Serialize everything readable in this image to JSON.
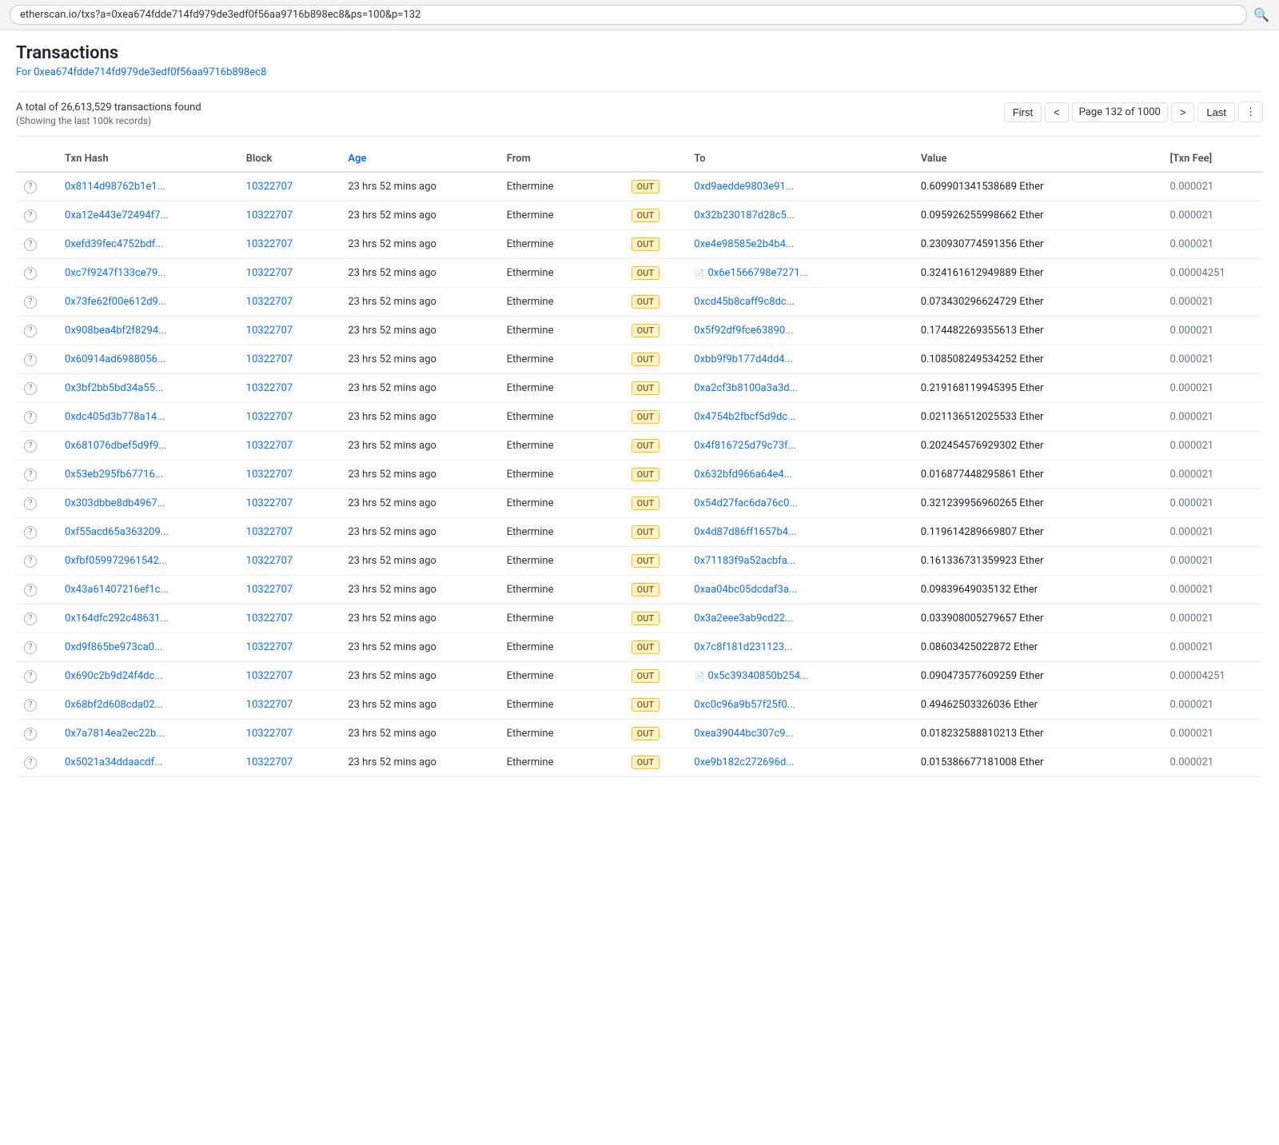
{
  "browser": {
    "url": "etherscan.io/txs?a=0xea674fdde714fd979de3edf0f56aa9716b898ec8&ps=100&p=132",
    "search_icon": "🔍"
  },
  "page": {
    "title": "Transactions",
    "address_label": "For 0xea674fdde714fd979de3edf0f56aa9716b898ec8",
    "address_href": "#"
  },
  "summary": {
    "total_text": "A total of 26,613,529 transactions found",
    "showing_text": "(Showing the last 100k records)"
  },
  "pagination": {
    "first_label": "First",
    "prev_label": "<",
    "page_info": "Page 132 of 1000",
    "next_label": ">",
    "last_label": "Last",
    "more_label": "⋮"
  },
  "table": {
    "columns": [
      {
        "id": "icon",
        "label": ""
      },
      {
        "id": "txn_hash",
        "label": "Txn Hash"
      },
      {
        "id": "block",
        "label": "Block"
      },
      {
        "id": "age",
        "label": "Age",
        "sortable": true
      },
      {
        "id": "from",
        "label": "From"
      },
      {
        "id": "direction",
        "label": ""
      },
      {
        "id": "to",
        "label": "To"
      },
      {
        "id": "value",
        "label": "Value"
      },
      {
        "id": "fee",
        "label": "[Txn Fee]"
      }
    ],
    "rows": [
      {
        "txn_hash": "0x8114d98762b1e1...",
        "block": "10322707",
        "age": "23 hrs 52 mins ago",
        "from": "Ethermine",
        "direction": "OUT",
        "to_icon": false,
        "to": "0xd9aedde9803e91...",
        "value": "0.609901341538689 Ether",
        "fee": "0.000021"
      },
      {
        "txn_hash": "0xa12e443e72494f7...",
        "block": "10322707",
        "age": "23 hrs 52 mins ago",
        "from": "Ethermine",
        "direction": "OUT",
        "to_icon": false,
        "to": "0x32b230187d28c5...",
        "value": "0.095926255998662 Ether",
        "fee": "0.000021"
      },
      {
        "txn_hash": "0xefd39fec4752bdf...",
        "block": "10322707",
        "age": "23 hrs 52 mins ago",
        "from": "Ethermine",
        "direction": "OUT",
        "to_icon": false,
        "to": "0xe4e98585e2b4b4...",
        "value": "0.230930774591356 Ether",
        "fee": "0.000021"
      },
      {
        "txn_hash": "0xc7f9247f133ce79...",
        "block": "10322707",
        "age": "23 hrs 52 mins ago",
        "from": "Ethermine",
        "direction": "OUT",
        "to_icon": true,
        "to": "0x6e1566798e7271...",
        "value": "0.324161612949889 Ether",
        "fee": "0.00004251"
      },
      {
        "txn_hash": "0x73fe62f00e612d9...",
        "block": "10322707",
        "age": "23 hrs 52 mins ago",
        "from": "Ethermine",
        "direction": "OUT",
        "to_icon": false,
        "to": "0xcd45b8caff9c8dc...",
        "value": "0.073430296624729 Ether",
        "fee": "0.000021"
      },
      {
        "txn_hash": "0x908bea4bf2f8294...",
        "block": "10322707",
        "age": "23 hrs 52 mins ago",
        "from": "Ethermine",
        "direction": "OUT",
        "to_icon": false,
        "to": "0x5f92df9fce63890...",
        "value": "0.174482269355613 Ether",
        "fee": "0.000021"
      },
      {
        "txn_hash": "0x60914ad6988056...",
        "block": "10322707",
        "age": "23 hrs 52 mins ago",
        "from": "Ethermine",
        "direction": "OUT",
        "to_icon": false,
        "to": "0xbb9f9b177d4dd4...",
        "value": "0.108508249534252 Ether",
        "fee": "0.000021"
      },
      {
        "txn_hash": "0x3bf2bb5bd34a55...",
        "block": "10322707",
        "age": "23 hrs 52 mins ago",
        "from": "Ethermine",
        "direction": "OUT",
        "to_icon": false,
        "to": "0xa2cf3b8100a3a3d...",
        "value": "0.219168119945395 Ether",
        "fee": "0.000021"
      },
      {
        "txn_hash": "0xdc405d3b778a14...",
        "block": "10322707",
        "age": "23 hrs 52 mins ago",
        "from": "Ethermine",
        "direction": "OUT",
        "to_icon": false,
        "to": "0x4754b2fbcf5d9dc...",
        "value": "0.021136512025533 Ether",
        "fee": "0.000021"
      },
      {
        "txn_hash": "0x681076dbef5d9f9...",
        "block": "10322707",
        "age": "23 hrs 52 mins ago",
        "from": "Ethermine",
        "direction": "OUT",
        "to_icon": false,
        "to": "0x4f816725d79c73f...",
        "value": "0.202454576929302 Ether",
        "fee": "0.000021"
      },
      {
        "txn_hash": "0x53eb295fb67716...",
        "block": "10322707",
        "age": "23 hrs 52 mins ago",
        "from": "Ethermine",
        "direction": "OUT",
        "to_icon": false,
        "to": "0x632bfd966a64e4...",
        "value": "0.016877448295861 Ether",
        "fee": "0.000021"
      },
      {
        "txn_hash": "0x303dbbe8db4967...",
        "block": "10322707",
        "age": "23 hrs 52 mins ago",
        "from": "Ethermine",
        "direction": "OUT",
        "to_icon": false,
        "to": "0x54d27fac6da76c0...",
        "value": "0.321239956960265 Ether",
        "fee": "0.000021"
      },
      {
        "txn_hash": "0xf55acd65a363209...",
        "block": "10322707",
        "age": "23 hrs 52 mins ago",
        "from": "Ethermine",
        "direction": "OUT",
        "to_icon": false,
        "to": "0x4d87d86ff1657b4...",
        "value": "0.119614289669807 Ether",
        "fee": "0.000021"
      },
      {
        "txn_hash": "0xfbf059972961542...",
        "block": "10322707",
        "age": "23 hrs 52 mins ago",
        "from": "Ethermine",
        "direction": "OUT",
        "to_icon": false,
        "to": "0x71183f9a52acbfa...",
        "value": "0.161336731359923 Ether",
        "fee": "0.000021"
      },
      {
        "txn_hash": "0x43a61407216ef1c...",
        "block": "10322707",
        "age": "23 hrs 52 mins ago",
        "from": "Ethermine",
        "direction": "OUT",
        "to_icon": false,
        "to": "0xaa04bc05dcdaf3a...",
        "value": "0.09839649035132 Ether",
        "fee": "0.000021"
      },
      {
        "txn_hash": "0x164dfc292c48631...",
        "block": "10322707",
        "age": "23 hrs 52 mins ago",
        "from": "Ethermine",
        "direction": "OUT",
        "to_icon": false,
        "to": "0x3a2eee3ab9cd22...",
        "value": "0.033908005279657 Ether",
        "fee": "0.000021"
      },
      {
        "txn_hash": "0xd9f865be973ca0...",
        "block": "10322707",
        "age": "23 hrs 52 mins ago",
        "from": "Ethermine",
        "direction": "OUT",
        "to_icon": false,
        "to": "0x7c8f181d231123...",
        "value": "0.08603425022872 Ether",
        "fee": "0.000021"
      },
      {
        "txn_hash": "0x690c2b9d24f4dc...",
        "block": "10322707",
        "age": "23 hrs 52 mins ago",
        "from": "Ethermine",
        "direction": "OUT",
        "to_icon": true,
        "to": "0x5c39340850b254...",
        "value": "0.090473577609259 Ether",
        "fee": "0.00004251"
      },
      {
        "txn_hash": "0x68bf2d608cda02...",
        "block": "10322707",
        "age": "23 hrs 52 mins ago",
        "from": "Ethermine",
        "direction": "OUT",
        "to_icon": false,
        "to": "0xc0c96a9b57f25f0...",
        "value": "0.49462503326036 Ether",
        "fee": "0.000021"
      },
      {
        "txn_hash": "0x7a7814ea2ec22b...",
        "block": "10322707",
        "age": "23 hrs 52 mins ago",
        "from": "Ethermine",
        "direction": "OUT",
        "to_icon": false,
        "to": "0xea39044bc307c9...",
        "value": "0.018232588810213 Ether",
        "fee": "0.000021"
      },
      {
        "txn_hash": "0x5021a34ddaacdf...",
        "block": "10322707",
        "age": "23 hrs 52 mins ago",
        "from": "Ethermine",
        "direction": "OUT",
        "to_icon": false,
        "to": "0xe9b182c272696d...",
        "value": "0.015386677181008 Ether",
        "fee": "0.000021"
      }
    ]
  }
}
